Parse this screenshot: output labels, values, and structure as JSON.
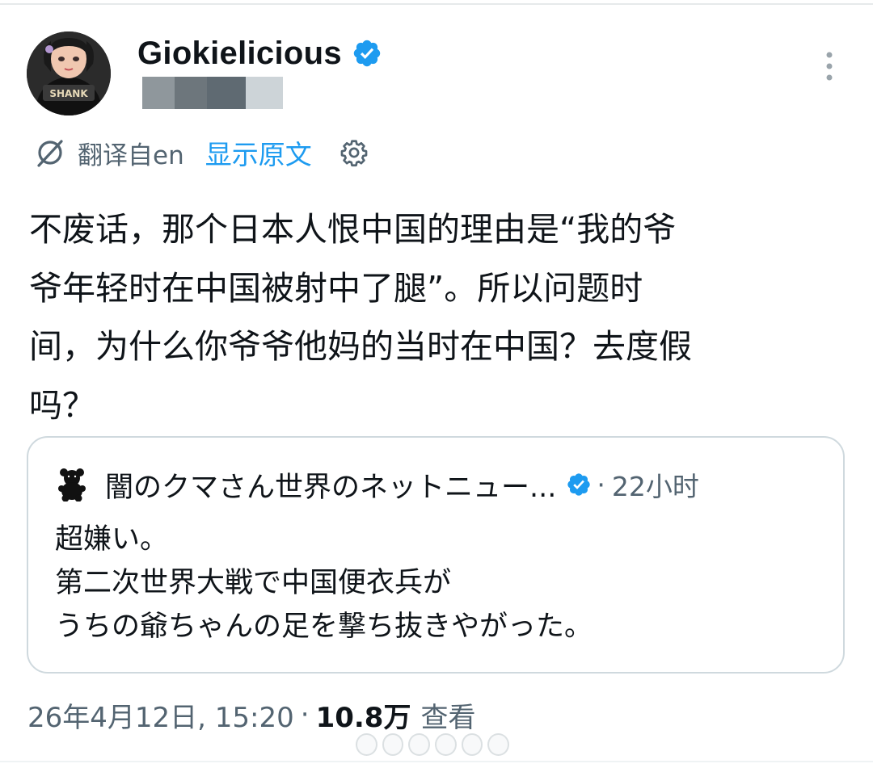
{
  "author": {
    "display_name": "Giokielicious",
    "verified": true,
    "avatar_text": "SHANK"
  },
  "translation": {
    "label": "翻译自en",
    "show_original": "显示原文"
  },
  "tweet": {
    "text": "不废话，那个日本人恨中国的理由是“我的爷\n爷年轻时在中国被射中了腿”。所以问题时\n间，为什么你爷爷他妈的当时在中国？去度假\n吗？"
  },
  "quoted_tweet": {
    "author_name": "闇のクマさん世界のネットニュー...",
    "separator": "·",
    "time": "22小时",
    "text": "超嫌い。\n第二次世界大戦で中国便衣兵が\nうちの爺ちゃんの足を撃ち抜きやがった。"
  },
  "meta": {
    "date": "26年4月12日, 15:20",
    "separator": "·",
    "views_count": "10.8万",
    "views_label": "查看"
  },
  "colors": {
    "accent": "#1d9bf0",
    "text_primary": "#0f1419",
    "text_secondary": "#536471",
    "border": "#cfd9de"
  },
  "icons": {
    "verified": "verified-badge-icon",
    "more": "more-vertical-icon",
    "translate": "translate-icon",
    "settings": "gear-icon",
    "bear": "bear-icon"
  }
}
